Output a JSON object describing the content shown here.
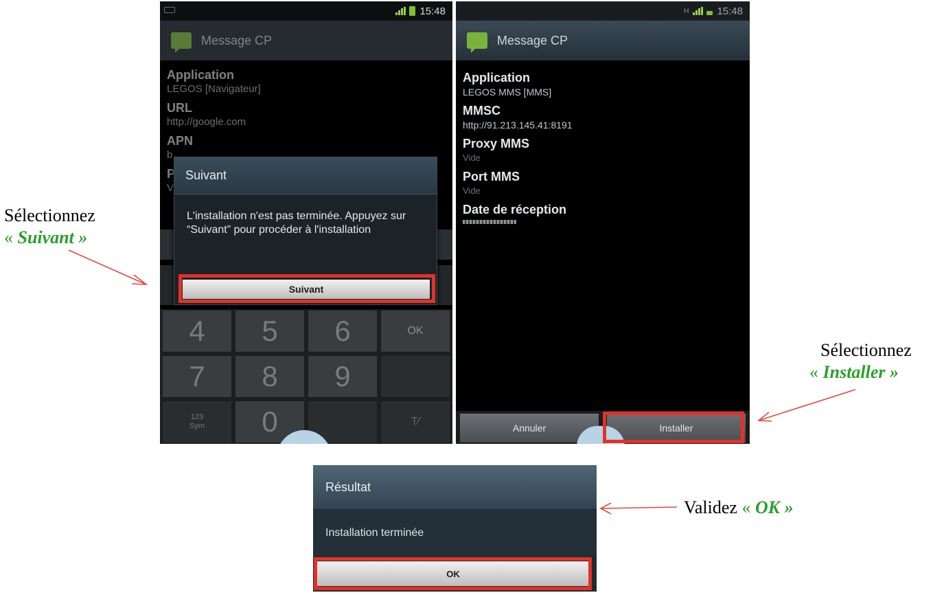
{
  "annotations": {
    "left": {
      "line1": "Sélectionnez",
      "open": "« ",
      "action": "Suivant",
      "close": " »"
    },
    "right": {
      "line1": "Sélectionnez",
      "open": "« ",
      "action": "Installer",
      "close": " »"
    },
    "bottom": {
      "prefix": "Validez ",
      "open": "« ",
      "action": "OK",
      "close": " »"
    },
    "highlight_color": "#e43126",
    "arrow_color": "#e04a3a",
    "action_color": "#2aa02a"
  },
  "phone1": {
    "status_time": "15:48",
    "app_title": "Message CP",
    "fields": [
      {
        "label": "Application",
        "value": "LEGOS [Navigateur]"
      },
      {
        "label": "URL",
        "value": "http://google.com"
      },
      {
        "label": "APN",
        "value": "b"
      },
      {
        "label": "P",
        "value": "V"
      }
    ],
    "dialog": {
      "title": "Suivant",
      "message": "L'installation n'est pas terminée. Appuyez sur “Suivant” pour procéder à l'installation",
      "button": "Suivant"
    },
    "keypad": {
      "keys": [
        "4",
        "5",
        "6",
        "OK",
        "7",
        "8",
        "9",
        "",
        "123\nSym",
        "0",
        "",
        "T⁄"
      ]
    }
  },
  "phone2": {
    "status_time": "15:48",
    "app_title": "Message CP",
    "fields": [
      {
        "label": "Application",
        "value": "LEGOS MMS [MMS]"
      },
      {
        "label": "MMSC",
        "value": "http://91.213.145.41:8191"
      },
      {
        "label": "Proxy MMS",
        "value": "Vide"
      },
      {
        "label": "Port MMS",
        "value": "Vide"
      },
      {
        "label": "Date de réception",
        "value": ""
      }
    ],
    "buttons": {
      "cancel": "Annuler",
      "install": "Installer"
    }
  },
  "result": {
    "title": "Résultat",
    "message": "Installation terminée",
    "button": "OK"
  }
}
